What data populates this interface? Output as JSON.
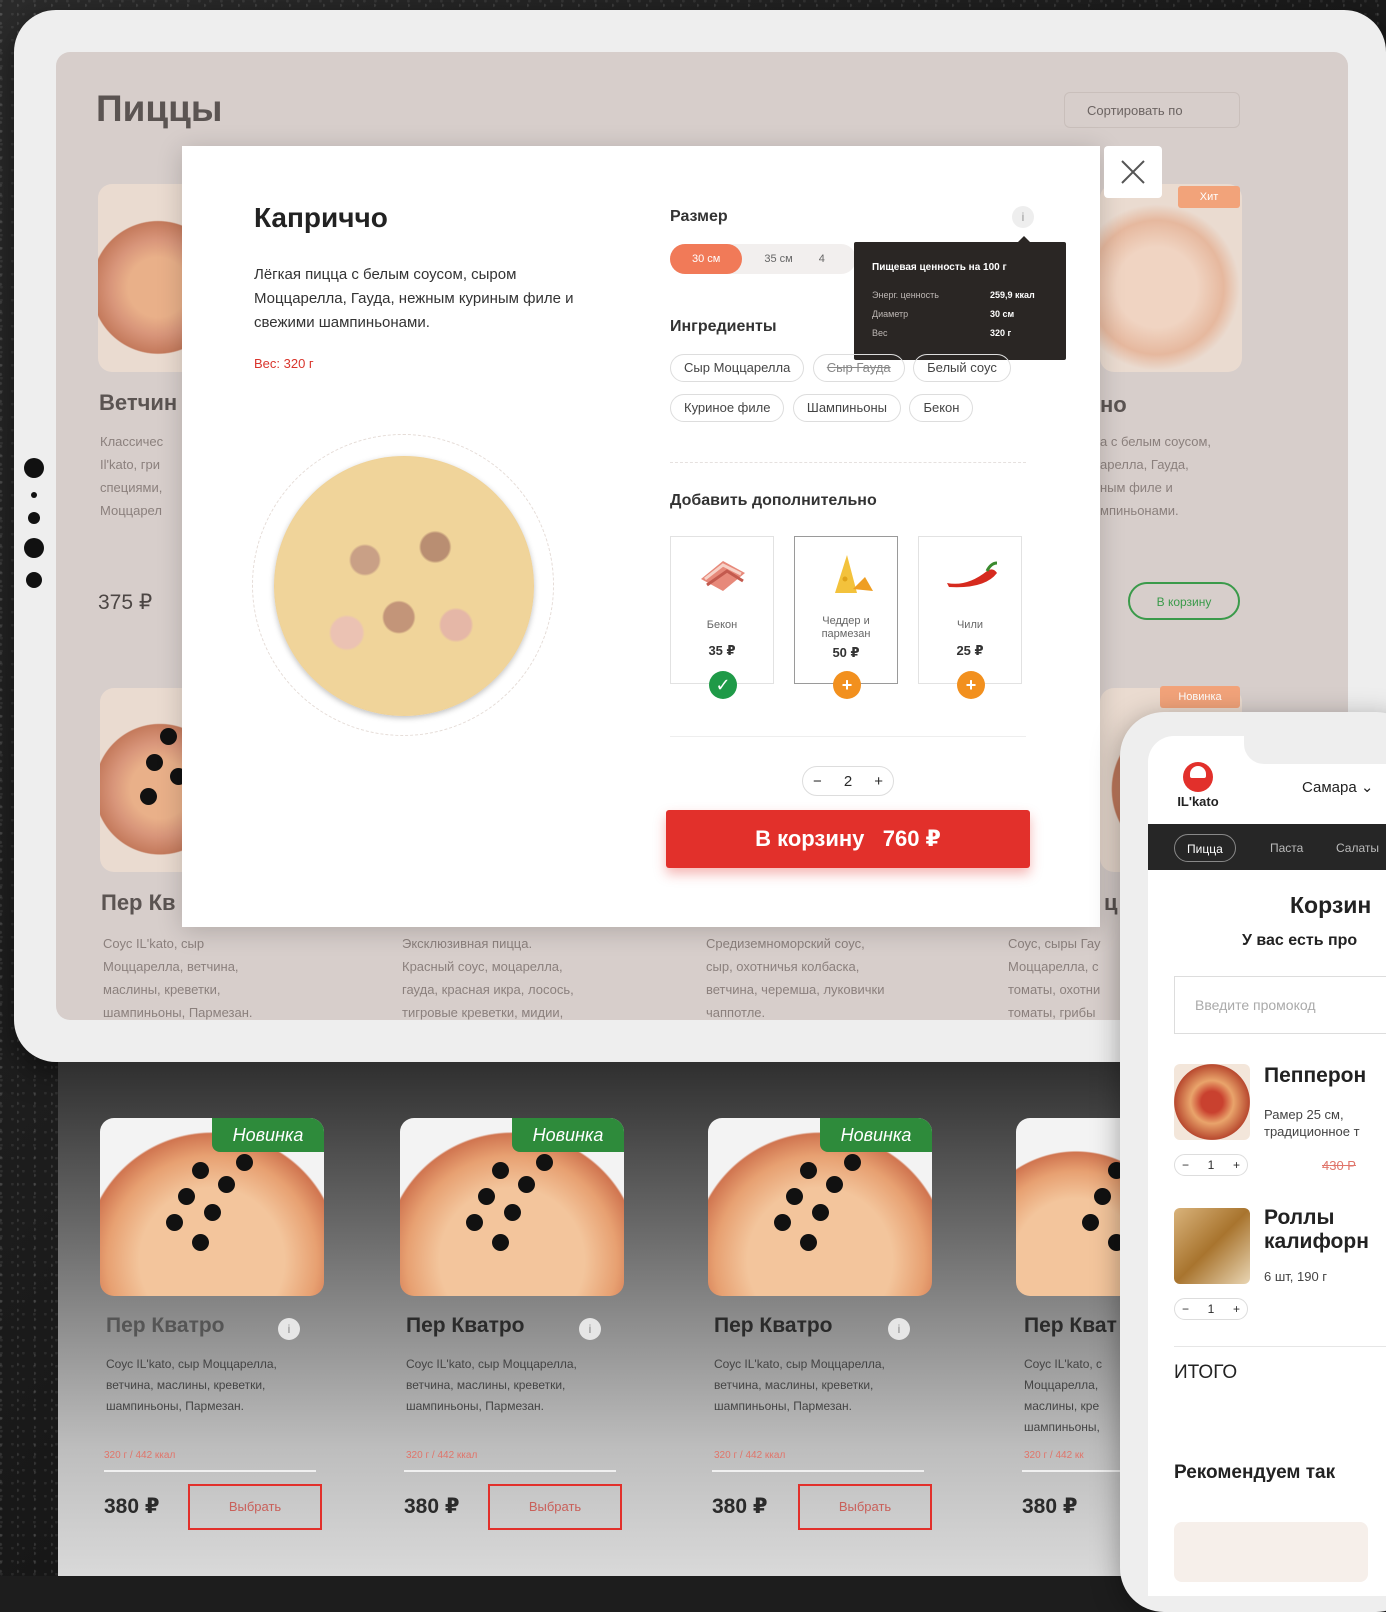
{
  "page": {
    "title": "Пиццы",
    "sort_label": "Сортировать по"
  },
  "background_cards": [
    {
      "name": "Ветчин",
      "desc": [
        "Классичес",
        "Il'kato, гри",
        "специями,",
        "Моццарел"
      ],
      "price": "375 ₽"
    },
    {
      "name": "Пер Кв",
      "desc": [
        "Соус IL'kato, сыр",
        "Моццарелла, ветчина,",
        "маслины, креветки,",
        "шампиньоны, Пармезан."
      ]
    },
    {
      "name": "",
      "desc": [
        "Эксклюзивная пицца.",
        "Красный соус, моцарелла,",
        "гауда, красная икра, лосось,",
        "тигровые креветки, мидии,"
      ]
    },
    {
      "name": "",
      "desc": [
        "Средиземноморский соус,",
        "сыр, охотничья колбаска,",
        "ветчина, черемша, луковички",
        "чаппотле."
      ]
    },
    {
      "name": "ц",
      "desc": [
        "Соус, сыры Гау",
        "Моццарелла, с",
        "томаты, охотни",
        "томаты, грибы"
      ]
    },
    {
      "name": "но",
      "desc": [
        "а с белым соусом,",
        "арелла, Гауда,",
        "ным филе и",
        "мпиньонами."
      ],
      "button": "В корзину",
      "tag": "Хит"
    }
  ],
  "tag_new_small": "Новинка",
  "modal": {
    "title": "Каприччо",
    "description": "Лёгкая пицца с белым соусом, сыром Моццарелла, Гауда, нежным куриным филе и свежими шампиньонами.",
    "weight": "Вес: 320 г",
    "size_label": "Размер",
    "sizes": [
      "30 см",
      "35 см",
      "4"
    ],
    "info_icon": "i",
    "nutrition": {
      "title": "Пищевая ценность  на 100 г",
      "rows": [
        {
          "label": "Энерг. ценность",
          "value": "259,9 ккал"
        },
        {
          "label": "Диаметр",
          "value": "30 см"
        },
        {
          "label": "Вес",
          "value": "320 г"
        }
      ]
    },
    "ingredients_label": "Ингредиенты",
    "ingredients": [
      {
        "name": "Сыр Моццарелла",
        "removed": false
      },
      {
        "name": "Сыр Гауда",
        "removed": true
      },
      {
        "name": "Белый соус",
        "removed": false
      },
      {
        "name": "Куриное филе",
        "removed": false
      },
      {
        "name": "Шампиньоны",
        "removed": false
      },
      {
        "name": "Бекон",
        "removed": false
      }
    ],
    "extras_label": "Добавить дополнительно",
    "extras": [
      {
        "name": "Бекон",
        "price": "35 ₽",
        "selected": true
      },
      {
        "name": "Чеддер и пармезан",
        "price": "50 ₽",
        "selected": false
      },
      {
        "name": "Чили",
        "price": "25 ₽",
        "selected": false
      }
    ],
    "quantity": "2",
    "minus": "−",
    "plus": "+",
    "cart_button": "В корзину   760 ₽"
  },
  "products": [
    {
      "tag": "Новинка",
      "name": "Пер Кватро",
      "desc": "Соус IL'kato, сыр Моццарелла, ветчина, маслины, креветки, шампиньоны, Пармезан.",
      "kcal": "320 г / 442 ккал",
      "price": "380 ₽",
      "button": "Выбрать"
    },
    {
      "tag": "Новинка",
      "name": "Пер Кватро",
      "desc": "Соус IL'kato, сыр Моццарелла, ветчина, маслины, креветки, шампиньоны, Пармезан.",
      "kcal": "320 г / 442 ккал",
      "price": "380 ₽",
      "button": "Выбрать"
    },
    {
      "tag": "Новинка",
      "name": "Пер Кватро",
      "desc": "Соус IL'kato, сыр Моццарелла, ветчина, маслины, креветки, шампиньоны, Пармезан.",
      "kcal": "320 г / 442 ккал",
      "price": "380 ₽",
      "button": "Выбрать"
    },
    {
      "tag": "",
      "name": "Пер Кват",
      "desc": "Соус IL'kato, с Моццарелла, маслины, кре шампиньоны,",
      "kcal": "320 г / 442 кк",
      "price": "380 ₽",
      "button": ""
    }
  ],
  "phone": {
    "logo": "IL'kato",
    "city": "Самара",
    "tabs": [
      "Пицца",
      "Паста",
      "Салаты"
    ],
    "cart_title": "Корзин",
    "promo_question": "У вас есть про",
    "promo_placeholder": "Введите промокод",
    "items": [
      {
        "name": "Пепперон",
        "sub": "Рамер 25 см, традиционное т",
        "qty": "1",
        "old_price": "430 Р"
      },
      {
        "name": "Роллы калифорн",
        "sub": "6 шт, 190 г",
        "qty": "1"
      }
    ],
    "total_label": "ИТОГО",
    "recommend_label": "Рекомендуем так"
  },
  "colors": {
    "accent_red": "#e2302b",
    "accent_orange": "#f17a58",
    "new_green": "#2e8b3b",
    "selected_green": "#1f9a48"
  }
}
